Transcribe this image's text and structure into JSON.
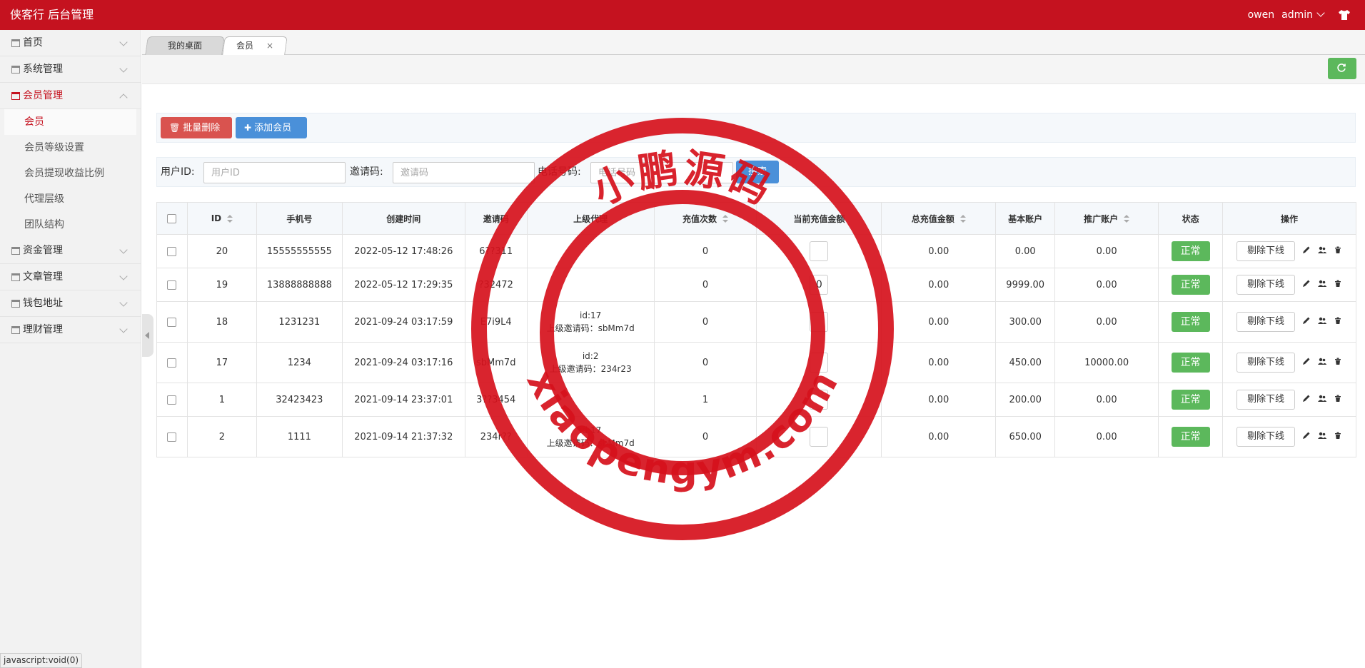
{
  "header": {
    "title": "侠客行 后台管理",
    "user": "owen",
    "role": "admin"
  },
  "sidebar": {
    "items": [
      {
        "label": "首页",
        "open": false
      },
      {
        "label": "系统管理",
        "open": false
      },
      {
        "label": "会员管理",
        "open": true,
        "children": [
          "会员",
          "会员等级设置",
          "会员提现收益比例",
          "代理层级",
          "团队结构"
        ]
      },
      {
        "label": "资金管理",
        "open": false
      },
      {
        "label": "文章管理",
        "open": false
      },
      {
        "label": "钱包地址",
        "open": false
      },
      {
        "label": "理财管理",
        "open": false
      }
    ],
    "active_child": "会员"
  },
  "tabs": [
    {
      "label": "我的桌面",
      "active": false
    },
    {
      "label": "会员",
      "active": true,
      "close": "×"
    }
  ],
  "actions": {
    "batch_delete": "批量删除",
    "add_member": "添加会员"
  },
  "search": {
    "user_id_label": "用户ID:",
    "user_id_placeholder": "用户ID",
    "invite_label": "邀请码:",
    "invite_placeholder": "邀请码",
    "phone_label": "电话号码:",
    "phone_placeholder": "电话号码",
    "submit": "搜索"
  },
  "table": {
    "columns": [
      "ID",
      "手机号",
      "创建时间",
      "邀请码",
      "上级代理",
      "充值次数",
      "当前充值金额",
      "总充值金额",
      "基本账户",
      "推广账户",
      "状态",
      "操作"
    ],
    "rows": [
      {
        "id": "20",
        "phone": "15555555555",
        "created": "2022-05-12 17:48:26",
        "invite": "6??311",
        "parent_id": "",
        "parent_code": "",
        "recharge_count": "0",
        "current_amount": "",
        "total_amount": "0.00",
        "basic": "0.00",
        "promo": "0.00",
        "status": "正常",
        "op": "剔除下线"
      },
      {
        "id": "19",
        "phone": "13888888888",
        "created": "2022-05-12 17:29:35",
        "invite": "?32472",
        "parent_id": "",
        "parent_code": "",
        "recharge_count": "0",
        "current_amount": "0",
        "total_amount": "0.00",
        "basic": "9999.00",
        "promo": "0.00",
        "status": "正常",
        "op": "剔除下线"
      },
      {
        "id": "18",
        "phone": "1231231",
        "created": "2021-09-24 03:17:59",
        "invite": "E7i9L4",
        "parent_id": "id:17",
        "parent_code": "上级邀请码：sbMm7d",
        "recharge_count": "0",
        "current_amount": "",
        "total_amount": "0.00",
        "basic": "300.00",
        "promo": "0.00",
        "status": "正常",
        "op": "剔除下线"
      },
      {
        "id": "17",
        "phone": "1234",
        "created": "2021-09-24 03:17:16",
        "invite": "sbMm7d",
        "parent_id": "id:2",
        "parent_code": "上级邀请码：234r23",
        "recharge_count": "0",
        "current_amount": "",
        "total_amount": "0.00",
        "basic": "450.00",
        "promo": "10000.00",
        "status": "正常",
        "op": "剔除下线"
      },
      {
        "id": "1",
        "phone": "32423423",
        "created": "2021-09-14 23:37:01",
        "invite": "3??3454",
        "parent_id": "",
        "parent_code": "",
        "recharge_count": "1",
        "current_amount": "",
        "total_amount": "0.00",
        "basic": "200.00",
        "promo": "0.00",
        "status": "正常",
        "op": "剔除下线"
      },
      {
        "id": "2",
        "phone": "1111",
        "created": "2021-09-14 21:37:32",
        "invite": "234r??",
        "parent_id": "id:17",
        "parent_code": "上级邀请码：sbMm7d",
        "recharge_count": "0",
        "current_amount": "",
        "total_amount": "0.00",
        "basic": "650.00",
        "promo": "0.00",
        "status": "正常",
        "op": "剔除下线"
      }
    ]
  },
  "status_hint": "javascript:void(0)",
  "watermark": {
    "top_text": "小鹏源码",
    "bottom_text": "xiaopengym.com",
    "color": "#d6111c"
  },
  "colors": {
    "brand": "#c5121f",
    "success": "#5cb85c",
    "danger": "#d9534f",
    "primary": "#4a90d9"
  }
}
